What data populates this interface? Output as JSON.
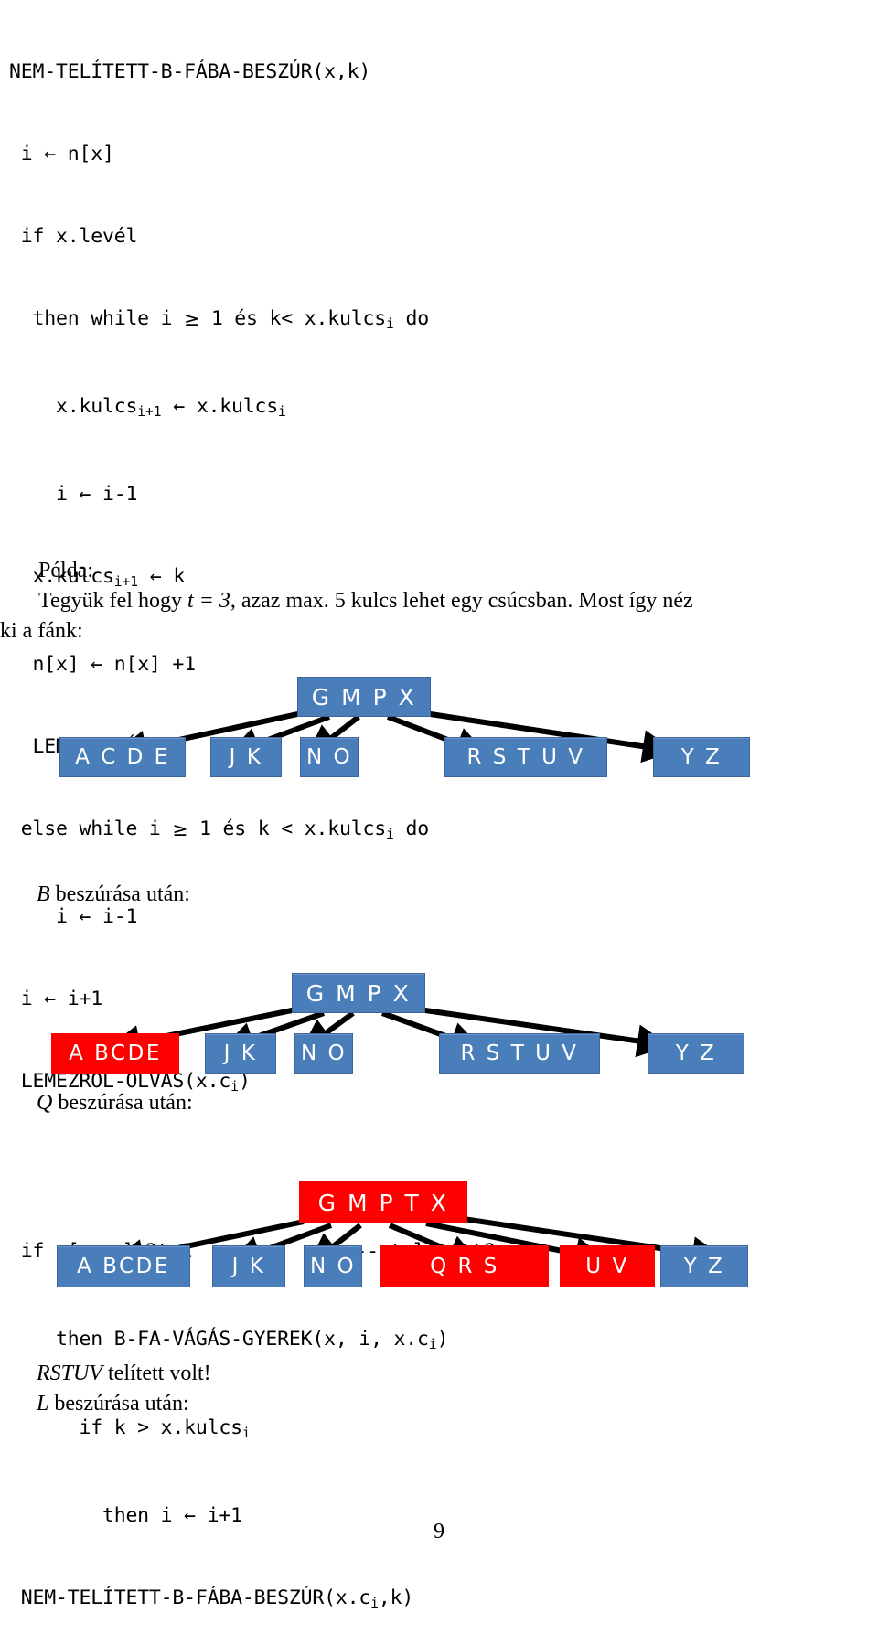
{
  "page": {
    "number": "9"
  },
  "pseudocode": {
    "lines": [
      "NEM-TELÍTETT-B-FÁBA-BESZÚR(x,k)",
      " i ← n[x]",
      " if x.levél",
      "  then while i ≥ 1 és k< x.kulcs_i do",
      "     x.kulcs_{i+1} ← x.kulcs_i",
      "     i ← i-1",
      "  x.kulcs_{i+1} ← k",
      "  n[x] ← n[x] +1",
      "  LEMEZRE-ÍR(x)",
      " else while i ≥ 1 és k < x.kulcs_i do",
      "     i ← i-1",
      " i ← i+1",
      " LEMEZRŐL-OLVAS(x.c_i)",
      "",
      " if n[x.c_i]=2t-1              -- telített?",
      "    then B-FA-VÁGÁS-GYEREK(x, i, x.c_i)",
      "      if k > x.kulcs_i",
      "        then i ← i+1",
      " NEM-TELÍTETT-B-FÁBA-BESZÚR(x.c_i,k)"
    ],
    "title": "NEM-TELÍTETT-B-FÁBA-BESZÚR(x,k)",
    "comment_telitett": "-- telített?"
  },
  "prose": {
    "pelda_label": "Példa:",
    "example_sentence_part1": "Tegyük fel hogy ",
    "example_t_equation": "t = 3",
    "example_sentence_part2": ", azaz max. 5 kulcs lehet egy csúcsban. Most így néz",
    "example_sentence_line2": "ki a fánk:",
    "caption_b": "B",
    "caption_b_rest": " beszúrása után:",
    "caption_q": "Q",
    "caption_q_rest": " beszúrása után:",
    "note_rstuv": "RSTUV",
    "note_rstuv_rest": " telített volt!",
    "caption_l": "L",
    "caption_l_rest": " beszúrása után:"
  },
  "colors": {
    "node_blue": "#4a7ebb",
    "node_red": "#ff0000",
    "node_text": "#ffffff",
    "edge": "#000000"
  },
  "trees": [
    {
      "id": "tree-initial",
      "root": {
        "label": "G M P X",
        "color": "blue"
      },
      "children": [
        {
          "label": "A C D E",
          "color": "blue"
        },
        {
          "label": "J K",
          "color": "blue"
        },
        {
          "label": "N O",
          "color": "blue"
        },
        {
          "label": "R S T U V",
          "color": "blue"
        },
        {
          "label": "Y Z",
          "color": "blue"
        }
      ]
    },
    {
      "id": "tree-after-b",
      "root": {
        "label": "G M P X",
        "color": "blue"
      },
      "children": [
        {
          "label": "A BCDE",
          "color": "red"
        },
        {
          "label": "J K",
          "color": "blue"
        },
        {
          "label": "N O",
          "color": "blue"
        },
        {
          "label": "R S T U V",
          "color": "blue"
        },
        {
          "label": "Y Z",
          "color": "blue"
        }
      ]
    },
    {
      "id": "tree-after-q",
      "root": {
        "label": "G M P T X",
        "color": "red"
      },
      "children": [
        {
          "label": "A BCDE",
          "color": "blue"
        },
        {
          "label": "J K",
          "color": "blue"
        },
        {
          "label": "N O",
          "color": "blue"
        },
        {
          "label": "Q R S",
          "color": "red"
        },
        {
          "label": "U V",
          "color": "red"
        },
        {
          "label": "Y Z",
          "color": "blue"
        }
      ]
    }
  ]
}
